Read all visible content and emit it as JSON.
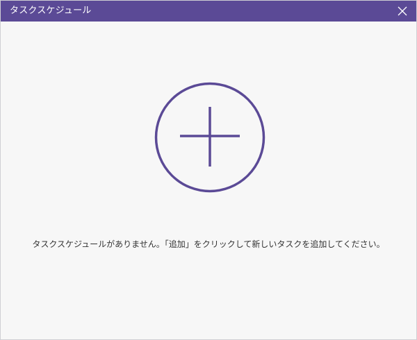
{
  "window": {
    "title": "タスクスケジュール",
    "close_icon": "close-icon"
  },
  "main": {
    "add_icon": "plus-circle-icon",
    "empty_message": "タスクスケジュールがありません。「追加」をクリックして新しいタスクを追加してください。"
  },
  "colors": {
    "titlebar": "#5b4a96",
    "accent": "#5b4a96",
    "background": "#f7f7f7"
  }
}
